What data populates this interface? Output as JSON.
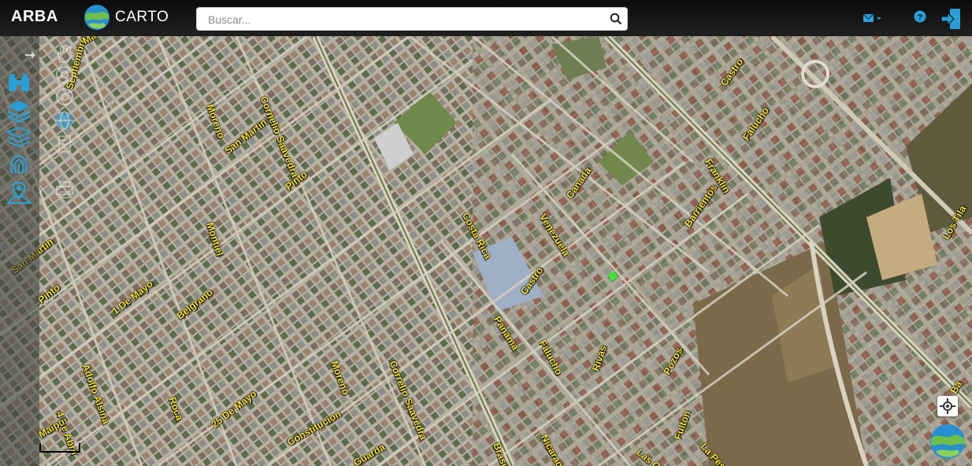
{
  "header": {
    "brand": "ARBA",
    "logo_text": "CARTO",
    "search_placeholder": "Buscar...",
    "icons": [
      "search-icon",
      "mail-icon",
      "help-icon",
      "logout-icon"
    ]
  },
  "left_toolbar": {
    "icons": [
      "expand-arrow-icon",
      "binoculars-icon",
      "layers-icon",
      "layers-stack-icon",
      "fingerprint-icon",
      "map-pin-icon"
    ]
  },
  "map_tools": {
    "icons": [
      "pan-hand-icon",
      "target-icon",
      "target-icon",
      "globe-icon",
      "document-icon",
      "printer-icon"
    ]
  },
  "map": {
    "streets": [
      "Septiembre",
      "Moreno",
      "Cornelio Saavedra",
      "San Martin",
      "Pinto",
      "Montiel",
      "Belgrano",
      "1 De Mayo",
      "Pinto",
      "San Martin",
      "Adolfo Alsina",
      "4 De Abril",
      "Roca",
      "25 De Mayo",
      "Constitucion",
      "Correlio Saavedra",
      "Moreno",
      "Costa Rica",
      "Venezuela",
      "Canada",
      "Castro",
      "Panama",
      "Falucho",
      "Rivas",
      "Pozos",
      "Nicaragua",
      "Barrientos",
      "Franklin",
      "Falucho",
      "Castro",
      "Brasil",
      "Las Chi",
      "Fulton",
      "La Pesqu",
      "Los Tila",
      "Guarda",
      "Maipu",
      "Ma",
      "Ba"
    ],
    "marker_color": "#39e639"
  }
}
